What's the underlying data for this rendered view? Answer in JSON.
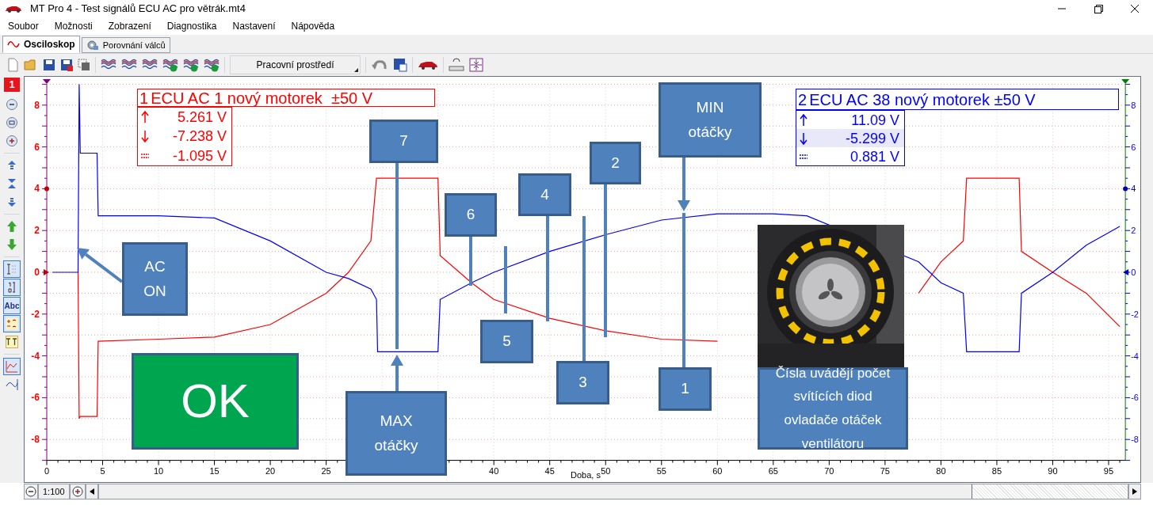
{
  "window": {
    "title": "MT Pro 4 - Test signálů ECU AC pro větrák.mt4"
  },
  "menu": [
    "Soubor",
    "Možnosti",
    "Zobrazení",
    "Diagnostika",
    "Nastavení",
    "Nápověda"
  ],
  "tabs": [
    {
      "label": "Osciloskop",
      "selected": true
    },
    {
      "label": "Porovnání válců",
      "selected": false
    }
  ],
  "toolbar": {
    "workspace": "Pracovní prostředí"
  },
  "left_toolbar": {
    "channel": "1",
    "tools": [
      {
        "kind": "icon",
        "pressed": false
      },
      {
        "kind": "icon",
        "pressed": false
      },
      {
        "kind": "icon",
        "pressed": false
      },
      {
        "kind": "icon",
        "pressed": false
      },
      {
        "kind": "icon",
        "pressed": false
      },
      {
        "kind": "icon",
        "pressed": false
      },
      {
        "kind": "icon",
        "pressed": false
      },
      {
        "kind": "icon",
        "pressed": false
      },
      {
        "kind": "icon",
        "pressed": true
      },
      {
        "kind": "icon",
        "pressed": true
      },
      {
        "kind": "text",
        "label": "Abc",
        "pressed": true
      },
      {
        "kind": "icon",
        "pressed": true
      },
      {
        "kind": "icon",
        "pressed": false
      },
      {
        "kind": "icon",
        "pressed": true
      },
      {
        "kind": "icon",
        "pressed": false
      }
    ]
  },
  "channels": [
    {
      "number": "1",
      "name": "ECU AC 1 nový motorek  ±50 V",
      "color": "#ff0000",
      "readings": [
        {
          "kind": "max",
          "value": "5.261 V",
          "highlighted": false
        },
        {
          "kind": "min",
          "value": "-7.238 V",
          "highlighted": false
        },
        {
          "kind": "avg",
          "value": "-1.095 V",
          "highlighted": false
        }
      ]
    },
    {
      "number": "2",
      "name": "ECU AC 38 nový motorek ±50 V",
      "color": "#0000ff",
      "readings": [
        {
          "kind": "max",
          "value": "11.09 V",
          "highlighted": false
        },
        {
          "kind": "min",
          "value": "-5.299 V",
          "highlighted": true
        },
        {
          "kind": "avg",
          "value": "0.881 V",
          "highlighted": false
        }
      ]
    }
  ],
  "chart_data": {
    "type": "line",
    "xlabel": "Doba, s",
    "xlim": [
      0,
      96.5
    ],
    "ylim": [
      -9,
      9
    ],
    "grid": true,
    "xticks": [
      0,
      5,
      10,
      15,
      20,
      25,
      40,
      45,
      50,
      55,
      60,
      65,
      70,
      75,
      80,
      85,
      90,
      95
    ],
    "yticks": [
      8,
      6,
      4,
      2,
      0,
      -2,
      -4,
      -6,
      -8
    ],
    "x": [
      0.5,
      2.8,
      2.9,
      3.0,
      4.5,
      4.6,
      10,
      15,
      20,
      25,
      27,
      29,
      29.5,
      29.6,
      35,
      35.2,
      38,
      40,
      45,
      50,
      55,
      60,
      65,
      68,
      78,
      80,
      82,
      82.3,
      87,
      87.2,
      90,
      93,
      96
    ],
    "series": [
      {
        "color": "#ff0000",
        "values": [
          null,
          0,
          -7,
          -6.9,
          -6.9,
          -3.3,
          -3.2,
          -3.1,
          -2.5,
          -1,
          0,
          1.5,
          4.5,
          4.5,
          4.5,
          0.8,
          -0.5,
          -1.3,
          -2.2,
          -2.8,
          -3.2,
          -3.3,
          null,
          null,
          -1,
          0.5,
          1.5,
          4.5,
          4.5,
          1,
          0,
          -1,
          -2.6
        ]
      },
      {
        "color": "#0000ff",
        "values": [
          0,
          0,
          9,
          5.7,
          5.7,
          2.7,
          2.7,
          2.6,
          1.5,
          0,
          -0.3,
          -0.8,
          -1.3,
          -3.8,
          -3.8,
          -1.3,
          -0.5,
          0,
          1,
          1.8,
          2.5,
          2.8,
          2.8,
          2.7,
          0.5,
          -0.5,
          -1,
          -3.8,
          -3.8,
          -1,
          0,
          1.3,
          2.2
        ]
      }
    ]
  },
  "left_axis": {
    "ticks": [
      "8",
      "6",
      "4",
      "2",
      "0",
      "-2",
      "-4",
      "-6",
      "-8"
    ]
  },
  "right_axis": {
    "ticks": [
      "8",
      "6",
      "4",
      "2",
      "0",
      "-2",
      "-4",
      "-6",
      "-8"
    ]
  },
  "callouts": [
    {
      "text": "MIN\notáčky"
    },
    {
      "text": "7"
    },
    {
      "text": "MAX\notáčky"
    },
    {
      "text": "6"
    },
    {
      "text": "5"
    },
    {
      "text": "4"
    },
    {
      "text": "3"
    },
    {
      "text": "2"
    },
    {
      "text": "1"
    },
    {
      "text": "AC\nON"
    },
    {
      "text": "Čísla uvádějí počet svítících diod\novladače otáček ventilátoru"
    }
  ],
  "verdict": "OK",
  "bottom_bar": {
    "zoom": "1:100"
  }
}
